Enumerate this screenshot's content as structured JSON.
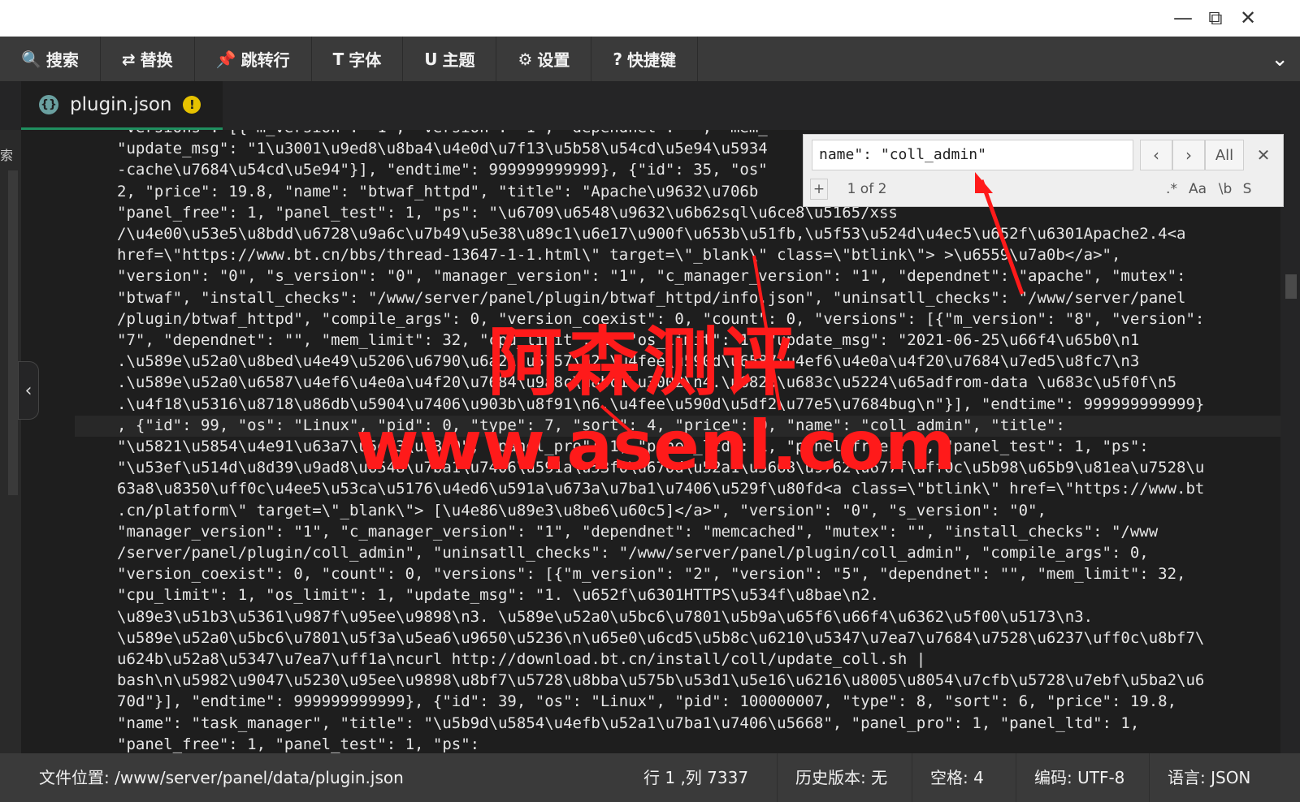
{
  "window": {
    "minimize": "—",
    "restore": "⧉",
    "close": "✕"
  },
  "toolbar": {
    "items": [
      {
        "icon": "🔍",
        "label": "搜索"
      },
      {
        "icon": "⇄",
        "label": "替换"
      },
      {
        "icon": "📌",
        "label": "跳转行"
      },
      {
        "icon": "T",
        "label": "字体"
      },
      {
        "icon": "U",
        "label": "主题"
      },
      {
        "icon": "⚙",
        "label": "设置"
      },
      {
        "icon": "?",
        "label": "快捷键"
      }
    ],
    "collapse": "⌄"
  },
  "tab": {
    "filename": "plugin.json",
    "warn": "!"
  },
  "leftpanel": {
    "label": "索",
    "collapse": "‹"
  },
  "find": {
    "query": "name\": \"coll_admin\"",
    "prev": "‹",
    "next": "›",
    "all": "All",
    "close": "✕",
    "add": "+",
    "count": "1 of 2",
    "regex": ".*",
    "case": "Aa",
    "word": "\\b",
    "sel": "S"
  },
  "editor": {
    "lines": [
      "\"versions\": [{\"m_version\": \"1\", \"version\": \"1\", \"dependnet\": \"\", \"mem_",
      "\"update_msg\": \"1\\u3001\\u9ed8\\u8ba4\\u4e0d\\u7f13\\u5b58\\u54cd\\u5e94\\u5934",
      "-cache\\u7684\\u54cd\\u5e94\"}], \"endtime\": 999999999999}, {\"id\": 35, \"os\"",
      "2, \"price\": 19.8, \"name\": \"btwaf_httpd\", \"title\": \"Apache\\u9632\\u706b",
      "\"panel_free\": 1, \"panel_test\": 1, \"ps\": \"\\u6709\\u6548\\u9632\\u6b62sql\\u6ce8\\u5165/xss",
      "/\\u4e00\\u53e5\\u8bdd\\u6728\\u9a6c\\u7b49\\u5e38\\u89c1\\u6e17\\u900f\\u653b\\u51fb,\\u5f53\\u524d\\u4ec5\\u652f\\u6301Apache2.4<a",
      "href=\\\"https://www.bt.cn/bbs/thread-13647-1-1.html\\\" target=\\\"_blank\\\" class=\\\"btlink\\\"> >\\u6559\\u7a0b</a>\",",
      "\"version\": \"0\", \"s_version\": \"0\", \"manager_version\": \"1\", \"c_manager_version\": \"1\", \"dependnet\": \"apache\", \"mutex\":",
      "\"btwaf\", \"install_checks\": \"/www/server/panel/plugin/btwaf_httpd/info.json\", \"uninsatll_checks\": \"/www/server/panel",
      "/plugin/btwaf_httpd\", \"compile_args\": 0, \"version_coexist\": 0, \"count\": 0, \"versions\": [{\"m_version\": \"8\", \"version\":",
      "\"7\", \"dependnet\": \"\", \"mem_limit\": 32, \"cpu_limit\": 1, \"os_limit\": 1, \"update_msg\": \"2021-06-25\\u66f4\\u65b0\\n1",
      ".\\u589e\\u52a0\\u8bed\\u4e49\\u5206\\u6790\\u6a21\\u5757\\n2.\\u4fee\\u590d\\u6587\\u4ef6\\u4e0a\\u4f20\\u7684\\u7ed5\\u8fc7\\n3",
      ".\\u589e\\u52a0\\u6587\\u4ef6\\u4e0a\\u4f20\\u7684\\u9a8c\\u8bc1\\u3002\\n4.\\u6825\\u683c\\u5224\\u65adfrom-data \\u683c\\u5f0f\\n5",
      ".\\u4f18\\u5316\\u8718\\u86db\\u5904\\u7406\\u903b\\u8f91\\n6.\\u4fee\\u590d\\u5df2\\u77e5\\u7684bug\\n\"}], \"endtime\": 999999999999}",
      ", {\"id\": 99, \"os\": \"Linux\", \"pid\": 0, \"type\": 7, \"sort\": 4, \"price\": 0, \"name\": \"coll_admin\", \"title\":",
      "\"\\u5821\\u5854\\u4e91\\u63a7\\u5e73\\u53f0\", \"panel_pro\": 1, \"panel_ltd\": 1, \"panel_free\": 1, \"panel_test\": 1, \"ps\":",
      "\"\\u53ef\\u514d\\u8d39\\u9ad8\\u6548\\u7ba1\\u7406\\u591a\\u53f0\\u670d\\u52a1\\u5668\\u9762\\u677f\\uff0c\\u5b98\\u65b9\\u81ea\\u7528\\u",
      "63a8\\u8350\\uff0c\\u4ee5\\u53ca\\u5176\\u4ed6\\u591a\\u673a\\u7ba1\\u7406\\u529f\\u80fd<a class=\\\"btlink\\\" href=\\\"https://www.bt",
      ".cn/platform\\\" target=\\\"_blank\\\"> [\\u4e86\\u89e3\\u8be6\\u60c5]</a>\", \"version\": \"0\", \"s_version\": \"0\",",
      "\"manager_version\": \"1\", \"c_manager_version\": \"1\", \"dependnet\": \"memcached\", \"mutex\": \"\", \"install_checks\": \"/www",
      "/server/panel/plugin/coll_admin\", \"uninsatll_checks\": \"/www/server/panel/plugin/coll_admin\", \"compile_args\": 0,",
      "\"version_coexist\": 0, \"count\": 0, \"versions\": [{\"m_version\": \"2\", \"version\": \"5\", \"dependnet\": \"\", \"mem_limit\": 32,",
      "\"cpu_limit\": 1, \"os_limit\": 1, \"update_msg\": \"1. \\u652f\\u6301HTTPS\\u534f\\u8bae\\n2.",
      "\\u89e3\\u51b3\\u5361\\u987f\\u95ee\\u9898\\n3. \\u589e\\u52a0\\u5bc6\\u7801\\u5b9a\\u65f6\\u66f4\\u6362\\u5f00\\u5173\\n3.",
      "\\u589e\\u52a0\\u5bc6\\u7801\\u5f3a\\u5ea6\\u9650\\u5236\\n\\u65e0\\u6cd5\\u5b8c\\u6210\\u5347\\u7ea7\\u7684\\u7528\\u6237\\uff0c\\u8bf7\\",
      "u624b\\u52a8\\u5347\\u7ea7\\uff1a\\ncurl http://download.bt.cn/install/coll/update_coll.sh |",
      "bash\\n\\u5982\\u9047\\u5230\\u95ee\\u9898\\u8bf7\\u5728\\u8bba\\u575b\\u53d1\\u5e16\\u6216\\u8005\\u8054\\u7cfb\\u5728\\u7ebf\\u5ba2\\u6",
      "70d\"}], \"endtime\": 999999999999}, {\"id\": 39, \"os\": \"Linux\", \"pid\": 100000007, \"type\": 8, \"sort\": 6, \"price\": 19.8,",
      "\"name\": \"task_manager\", \"title\": \"\\u5b9d\\u5854\\u4efb\\u52a1\\u7ba1\\u7406\\u5668\", \"panel_pro\": 1, \"panel_ltd\": 1,",
      "\"panel_free\": 1, \"panel_test\": 1, \"ps\":"
    ]
  },
  "watermark": {
    "line1": "阿森测评",
    "line2": "www.asenl.com"
  },
  "status": {
    "path": "文件位置: /www/server/panel/data/plugin.json",
    "pos": "行 1 ,列 7337",
    "history": "历史版本: 无",
    "space": "空格: 4",
    "encoding": "编码: UTF-8",
    "lang": "语言: JSON"
  }
}
